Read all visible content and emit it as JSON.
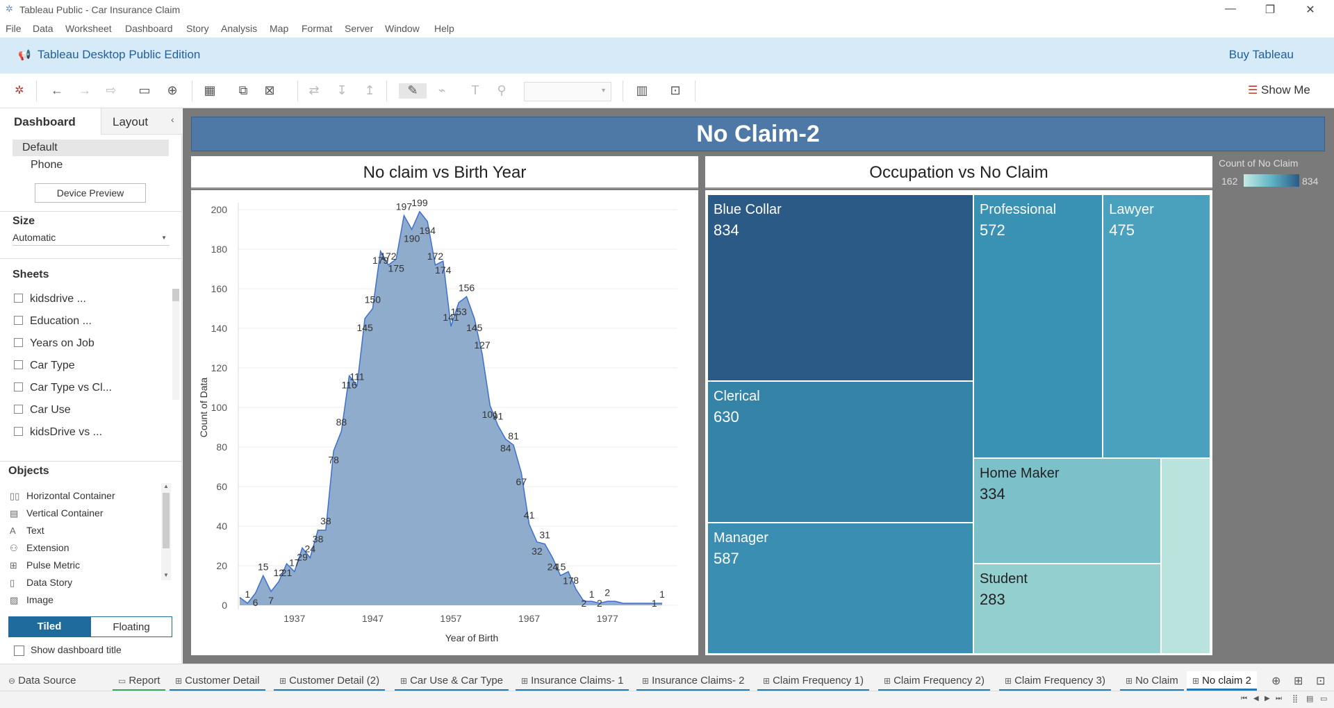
{
  "window": {
    "title": "Tableau Public - Car Insurance Claim"
  },
  "menu": [
    "File",
    "Data",
    "Worksheet",
    "Dashboard",
    "Story",
    "Analysis",
    "Map",
    "Format",
    "Server",
    "Window",
    "Help"
  ],
  "banner": {
    "edition": "Tableau Desktop Public Edition",
    "buy": "Buy Tableau"
  },
  "toolbar": {
    "show_me": "Show Me"
  },
  "left": {
    "tab_dashboard": "Dashboard",
    "tab_layout": "Layout",
    "device_default": "Default",
    "device_phone": "Phone",
    "device_preview": "Device Preview",
    "size_title": "Size",
    "size_value": "Automatic",
    "sheets_title": "Sheets",
    "sheets": [
      "kidsdrive ...",
      "Education ...",
      "Years on Job",
      "Car Type",
      "Car Type vs Cl...",
      "Car Use",
      "kidsDrive vs ..."
    ],
    "objects_title": "Objects",
    "objects": [
      {
        "label": "Horizontal Container",
        "icon": "horizontal-container-icon"
      },
      {
        "label": "Vertical Container",
        "icon": "vertical-container-icon"
      },
      {
        "label": "Text",
        "icon": "text-icon"
      },
      {
        "label": "Extension",
        "icon": "extension-icon"
      },
      {
        "label": "Pulse Metric",
        "icon": "pulse-metric-icon"
      },
      {
        "label": "Data Story",
        "icon": "data-story-icon"
      },
      {
        "label": "Image",
        "icon": "image-icon"
      }
    ],
    "tiled": "Tiled",
    "floating": "Floating",
    "show_title": "Show dashboard title"
  },
  "dashboard": {
    "title": "No Claim-2"
  },
  "chart_data": [
    {
      "type": "area",
      "title": "No claim vs Birth Year",
      "xlabel": "Year of Birth",
      "ylabel": "Count of Data",
      "ylim": [
        0,
        200
      ],
      "yticks": [
        0,
        20,
        40,
        60,
        80,
        100,
        120,
        140,
        160,
        180,
        200
      ],
      "xticks": [
        1937,
        1947,
        1957,
        1967,
        1977
      ],
      "x": [
        1930,
        1931,
        1932,
        1933,
        1934,
        1935,
        1936,
        1937,
        1938,
        1939,
        1940,
        1941,
        1942,
        1943,
        1944,
        1945,
        1946,
        1947,
        1948,
        1949,
        1950,
        1951,
        1952,
        1953,
        1954,
        1955,
        1956,
        1957,
        1958,
        1959,
        1960,
        1961,
        1962,
        1963,
        1964,
        1965,
        1966,
        1967,
        1968,
        1969,
        1970,
        1971,
        1972,
        1973,
        1974,
        1975,
        1976,
        1977,
        1978,
        1979,
        1980,
        1981,
        1982,
        1983,
        1984
      ],
      "values": [
        4,
        1,
        6,
        15,
        7,
        12,
        21,
        17,
        29,
        24,
        38,
        38,
        78,
        88,
        116,
        111,
        145,
        150,
        179,
        172,
        175,
        197,
        190,
        199,
        194,
        172,
        174,
        141,
        153,
        156,
        145,
        127,
        101,
        91,
        84,
        81,
        67,
        41,
        32,
        31,
        24,
        15,
        17,
        8,
        2,
        2,
        1,
        2,
        2,
        1,
        1,
        1,
        1,
        1,
        1
      ],
      "labels": [
        {
          "x": 1931,
          "v": 1
        },
        {
          "x": 1932,
          "v": 6
        },
        {
          "x": 1933,
          "v": 15
        },
        {
          "x": 1934,
          "v": 7
        },
        {
          "x": 1935,
          "v": 12
        },
        {
          "x": 1936,
          "v": 21
        },
        {
          "x": 1937,
          "v": 17
        },
        {
          "x": 1938,
          "v": 29
        },
        {
          "x": 1939,
          "v": 24
        },
        {
          "x": 1940,
          "v": 38
        },
        {
          "x": 1941,
          "v": 38
        },
        {
          "x": 1942,
          "v": 78
        },
        {
          "x": 1943,
          "v": 88
        },
        {
          "x": 1944,
          "v": 116
        },
        {
          "x": 1945,
          "v": 111
        },
        {
          "x": 1946,
          "v": 145
        },
        {
          "x": 1947,
          "v": 150
        },
        {
          "x": 1948,
          "v": 179
        },
        {
          "x": 1949,
          "v": 172
        },
        {
          "x": 1950,
          "v": 175
        },
        {
          "x": 1951,
          "v": 197
        },
        {
          "x": 1952,
          "v": 190
        },
        {
          "x": 1953,
          "v": 199
        },
        {
          "x": 1954,
          "v": 194
        },
        {
          "x": 1955,
          "v": 172
        },
        {
          "x": 1956,
          "v": 174
        },
        {
          "x": 1957,
          "v": 141
        },
        {
          "x": 1958,
          "v": 153
        },
        {
          "x": 1959,
          "v": 156
        },
        {
          "x": 1960,
          "v": 145
        },
        {
          "x": 1961,
          "v": 127
        },
        {
          "x": 1962,
          "v": 101
        },
        {
          "x": 1963,
          "v": 91
        },
        {
          "x": 1964,
          "v": 84
        },
        {
          "x": 1965,
          "v": 81
        },
        {
          "x": 1966,
          "v": 67
        },
        {
          "x": 1967,
          "v": 41
        },
        {
          "x": 1968,
          "v": 32
        },
        {
          "x": 1969,
          "v": 31
        },
        {
          "x": 1970,
          "v": 24
        },
        {
          "x": 1971,
          "v": 15
        },
        {
          "x": 1972,
          "v": 17
        },
        {
          "x": 1973,
          "v": 8
        },
        {
          "x": 1974,
          "v": 2
        },
        {
          "x": 1975,
          "v": 1
        },
        {
          "x": 1976,
          "v": 2
        },
        {
          "x": 1977,
          "v": 2
        },
        {
          "x": 1983,
          "v": 1
        },
        {
          "x": 1984,
          "v": 1
        }
      ],
      "fill": "#8faccd",
      "stroke": "#3d6fd1"
    },
    {
      "type": "treemap",
      "title": "Occupation vs No Claim",
      "legend_title": "Count of No Claim",
      "legend_min": 162,
      "legend_max": 834,
      "items": [
        {
          "name": "Blue Collar",
          "value": 834,
          "color": "#2c5a87"
        },
        {
          "name": "Clerical",
          "value": 630,
          "color": "#3584a7"
        },
        {
          "name": "Manager",
          "value": 587,
          "color": "#3a8eb2"
        },
        {
          "name": "Professional",
          "value": 572,
          "color": "#3991b3"
        },
        {
          "name": "Lawyer",
          "value": 475,
          "color": "#4aa1bd"
        },
        {
          "name": "Home Maker",
          "value": 334,
          "color": "#7cc1c9"
        },
        {
          "name": "Student",
          "value": 283,
          "color": "#93cfcf"
        },
        {
          "name": "",
          "value": 162,
          "color": "#b9e3dc"
        }
      ]
    }
  ],
  "tabs": [
    "Data Source",
    "Report",
    "Customer Detail",
    "Customer Detail (2)",
    "Car Use & Car Type",
    "Insurance Claims- 1",
    "Insurance Claims- 2",
    "Claim Frequency 1)",
    "Claim Frequency 2)",
    "Claim Frequency 3)",
    "No Claim",
    "No claim 2"
  ]
}
